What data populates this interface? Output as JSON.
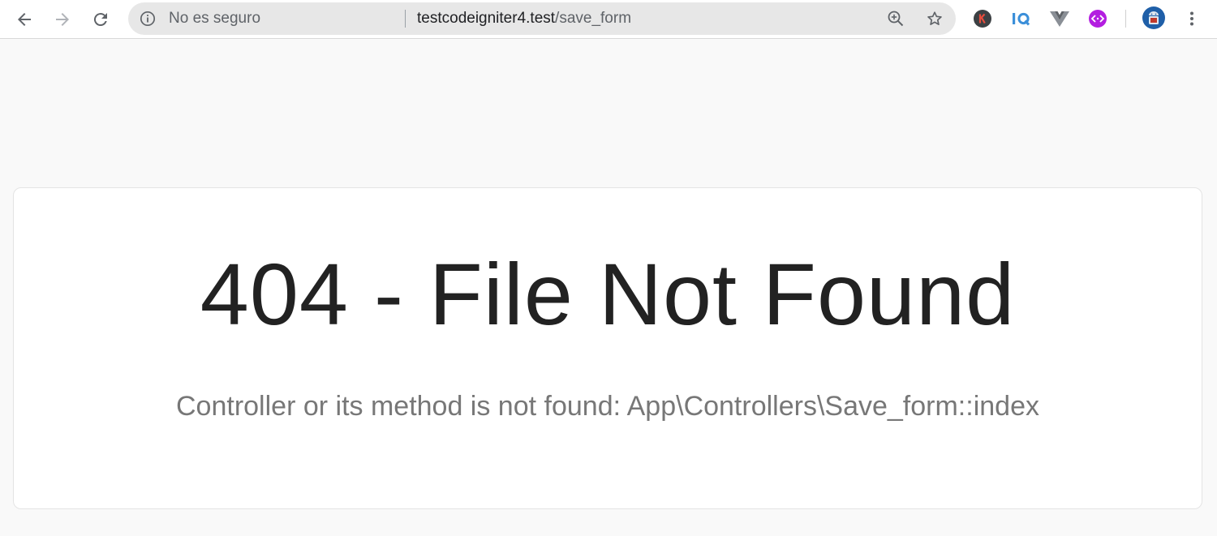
{
  "toolbar": {
    "security_label": "No es seguro",
    "url_host": "testcodeigniter4.test",
    "url_path": "/save_form",
    "extensions": [
      {
        "name": "k-extension",
        "glyph": "K",
        "color": "#3c4043",
        "text_color": "#e74c3c"
      },
      {
        "name": "iq-extension",
        "glyph": "IQ",
        "color": "#3b8fd9"
      },
      {
        "name": "vue-devtools",
        "color": "#8a8f96"
      },
      {
        "name": "purple-extension",
        "glyph": "⟨·⟩",
        "color": "#b31ee0"
      },
      {
        "name": "android-extension",
        "color": "#1f5fa8"
      }
    ]
  },
  "error": {
    "title": "404 - File Not Found",
    "message": "Controller or its method is not found: App\\Controllers\\Save_form::index"
  },
  "colors": {
    "page_background": "#f9f9f9",
    "title": "#222222",
    "message": "#777777"
  }
}
